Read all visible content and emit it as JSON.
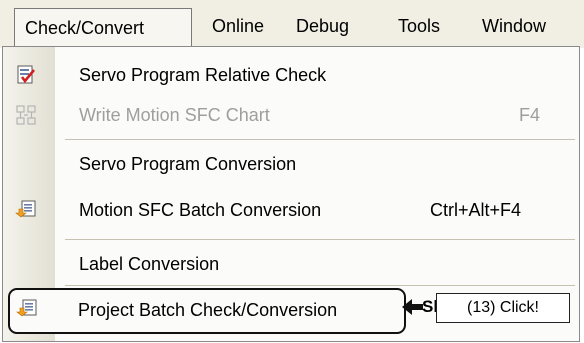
{
  "menubar": {
    "items": [
      {
        "label": "Check/Convert",
        "active": true
      },
      {
        "label": "Online"
      },
      {
        "label": "Debug"
      },
      {
        "label": "Tools"
      },
      {
        "label": "Window"
      }
    ]
  },
  "dropdown": {
    "items": [
      {
        "label": "Servo Program Relative Check",
        "icon": "relative-check-icon",
        "enabled": true
      },
      {
        "label": "Write Motion SFC Chart",
        "shortcut": "F4",
        "icon": "sfc-chart-icon",
        "enabled": false
      },
      {
        "label": "Servo Program Conversion",
        "enabled": true
      },
      {
        "label": "Motion SFC Batch Conversion",
        "shortcut": "Ctrl+Alt+F4",
        "icon": "batch-conversion-icon",
        "enabled": true
      },
      {
        "label": "Label Conversion",
        "enabled": true
      },
      {
        "label": "Project Batch Check/Conversion",
        "shortcut_partial": "Shif",
        "icon": "project-batch-icon",
        "enabled": true,
        "highlighted": true
      }
    ]
  },
  "annotation": {
    "callout": "(13) Click!"
  },
  "colors": {
    "menubar_bg": "#f1efe4",
    "dropdown_bg": "#fbfbf9",
    "disabled_text": "#9e9e9e",
    "icon_orange": "#f0a020",
    "icon_red": "#d02020"
  }
}
